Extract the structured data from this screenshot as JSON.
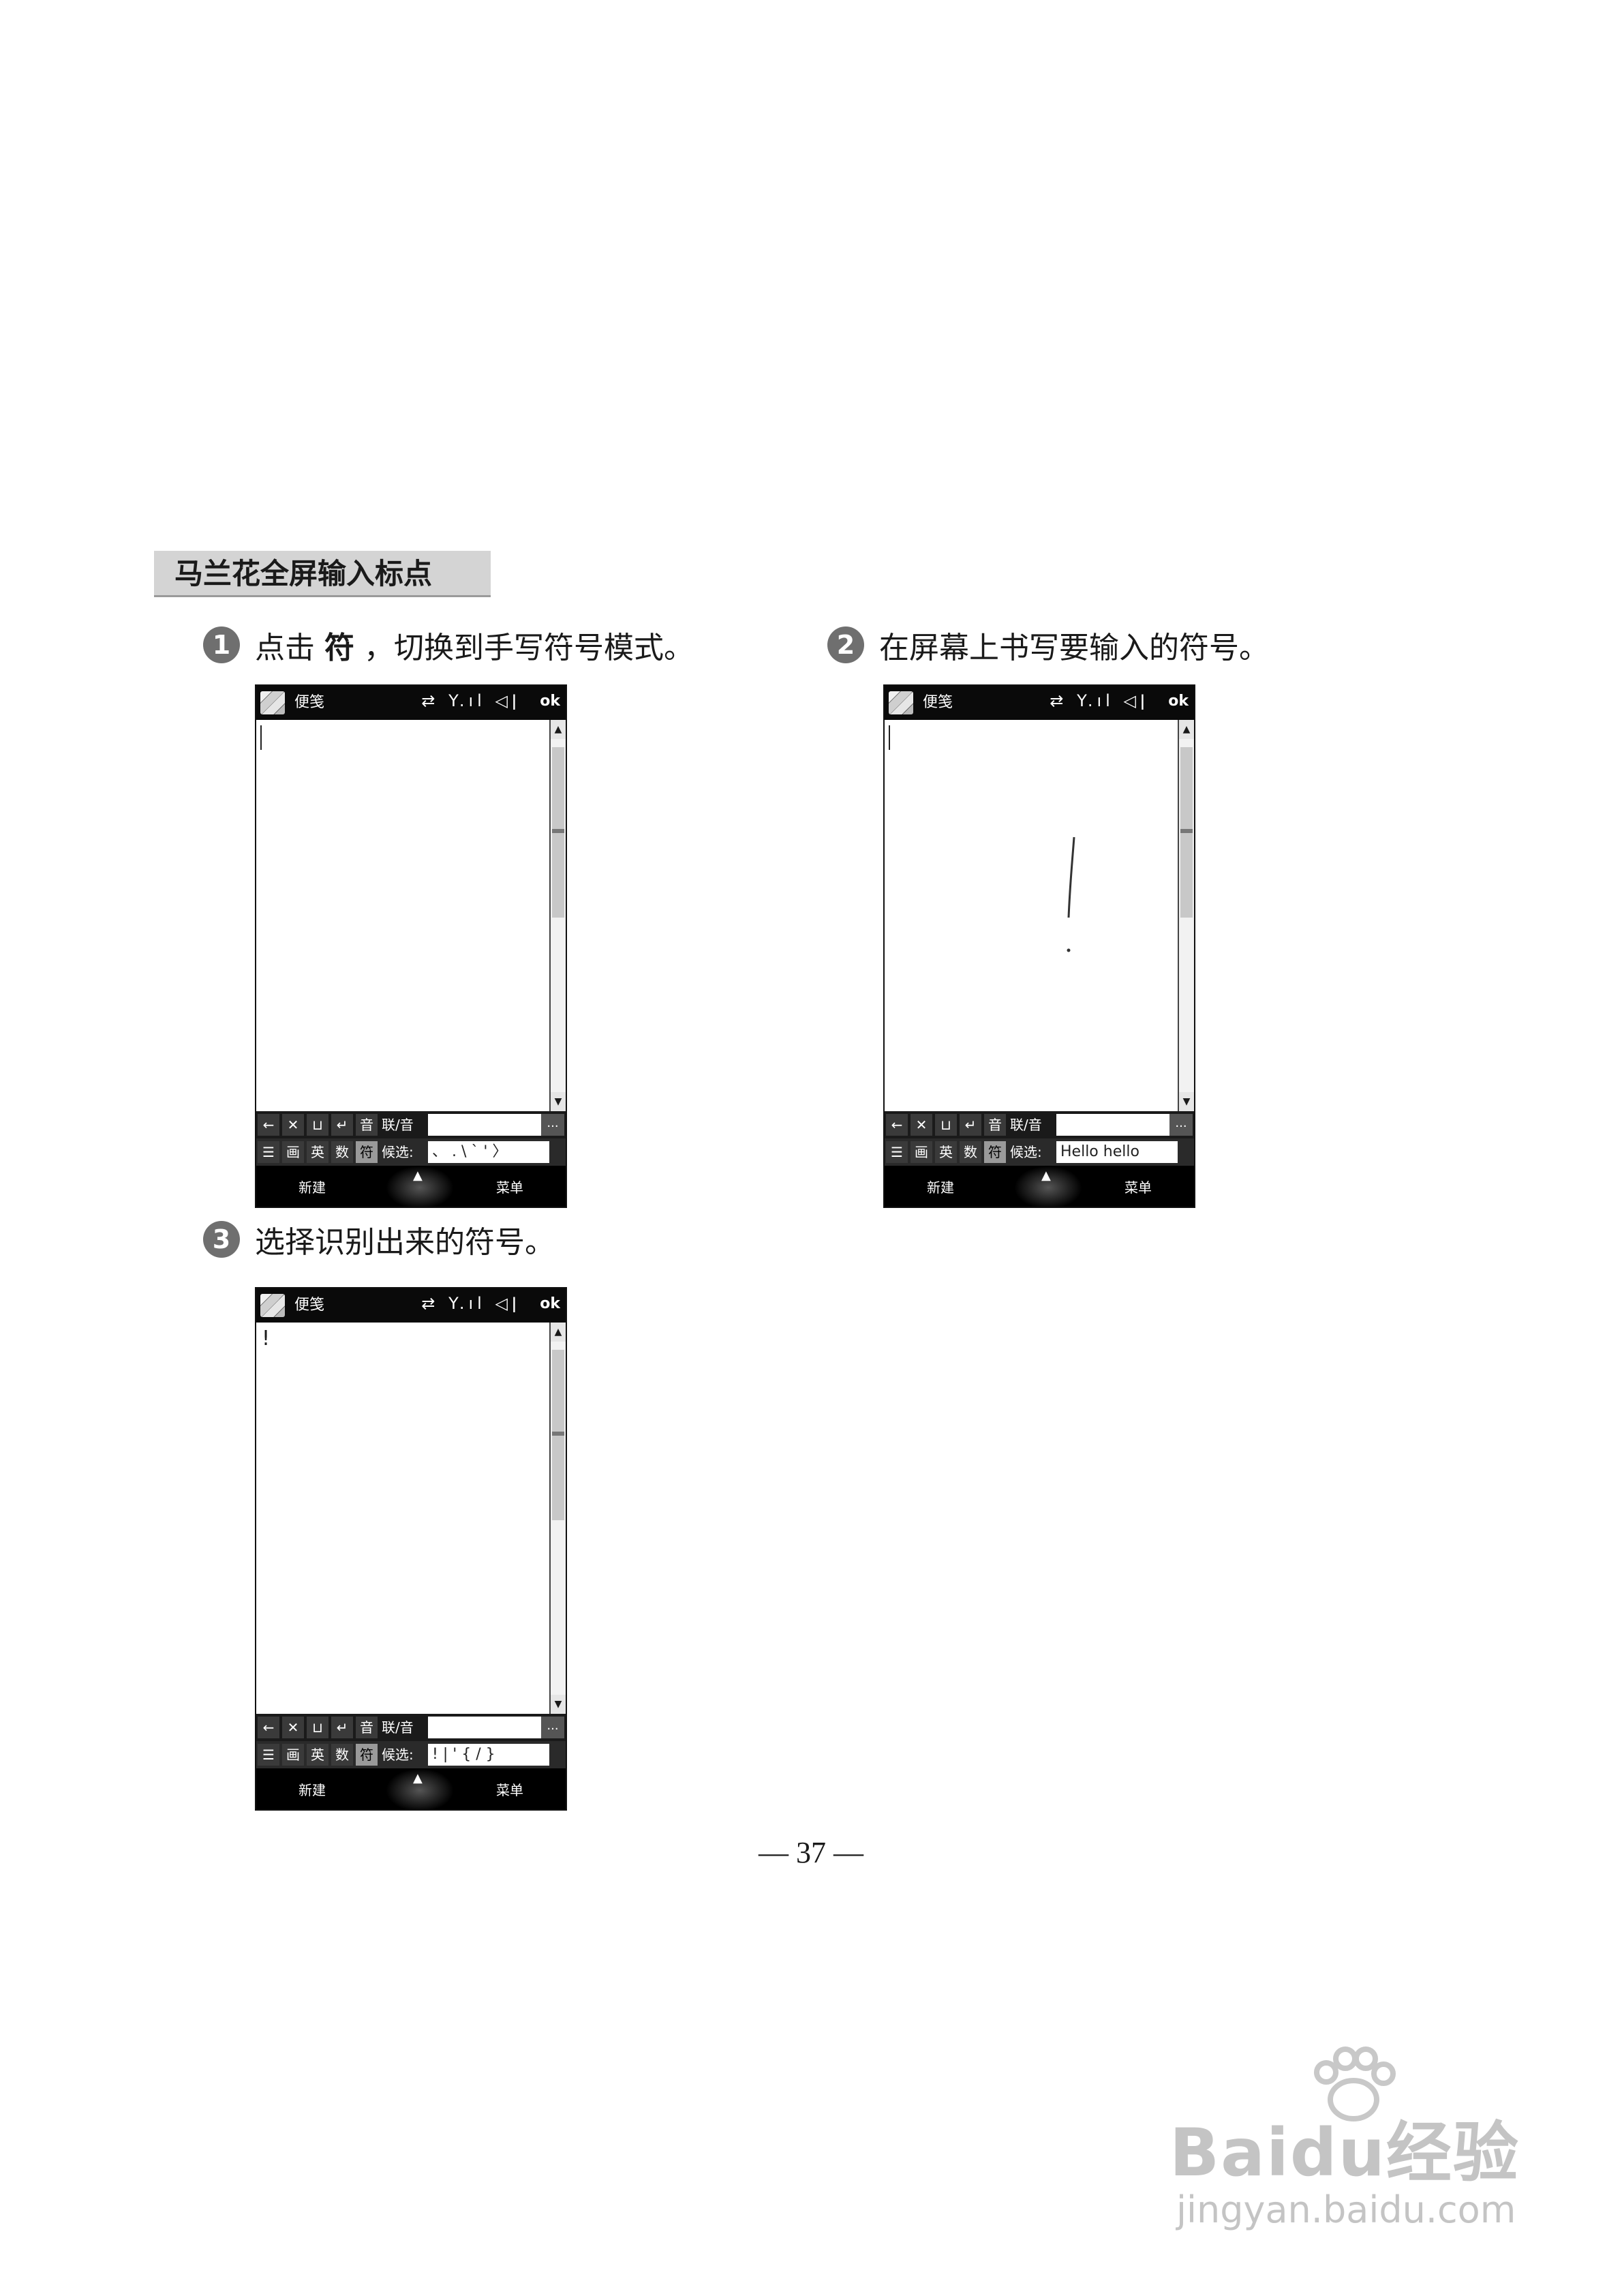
{
  "section": {
    "title": "马兰花全屏输入标点"
  },
  "steps": [
    {
      "num": "1",
      "pre": "点击",
      "bold": "符",
      "post": "，切换到手写符号模式。"
    },
    {
      "num": "2",
      "text": "在屏幕上书写要输入的符号。"
    },
    {
      "num": "3",
      "text": "选择识别出来的符号。"
    }
  ],
  "phone": {
    "app_title": "便笺",
    "status_icons": "⇄ Y.ıl ◁ǀ",
    "ok": "ok",
    "keys_row1": [
      "←",
      "✕",
      "⊔",
      "↵",
      "音",
      "联/音"
    ],
    "keys_row2": [
      "☰",
      "画",
      "英",
      "数",
      "符",
      "候选:"
    ],
    "more": "...",
    "left_soft": "新建",
    "right_soft": "菜单",
    "mid_soft": "▲"
  },
  "screens": [
    {
      "doc_text": "",
      "candidates": "、 .  \\  `  ' 〉"
    },
    {
      "doc_text": "",
      "candidates": "Hello hello Halo"
    },
    {
      "doc_text": "!",
      "candidates": "!  |  '  {  /  }"
    }
  ],
  "page_number": "— 37 —",
  "watermark": {
    "brand": "Baidu经验",
    "url": "jingyan.baidu.com"
  }
}
